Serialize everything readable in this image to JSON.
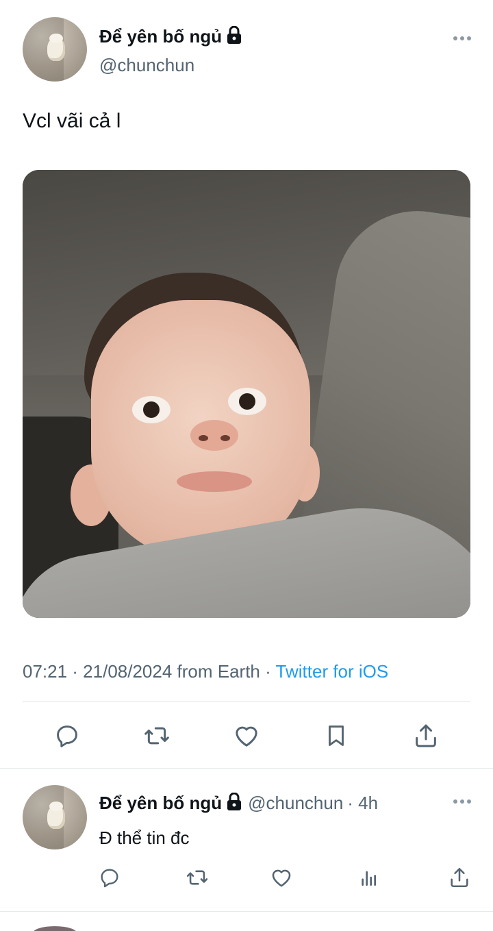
{
  "tweet": {
    "author_name": "Để yên bố ngủ",
    "author_handle": "@chunchun",
    "text": "Vcl vãi cả l",
    "time": "07:21 · 21/08/2024 from Earth · ",
    "source": "Twitter for iOS",
    "icons": {
      "lock": "lock-icon",
      "more": "more-horizontal-icon",
      "reply": "reply-icon",
      "retweet": "retweet-icon",
      "like": "heart-icon",
      "bookmark": "bookmark-icon",
      "share": "share-icon"
    }
  },
  "reply": {
    "author_name": "Để yên bố ngủ",
    "author_handle": "@chunchun",
    "time_ago": "· 4h",
    "text": "Đ thể tin đc",
    "icons": {
      "reply": "reply-icon",
      "retweet": "retweet-icon",
      "like": "heart-icon",
      "views": "analytics-icon",
      "share": "share-icon"
    }
  },
  "colors": {
    "text": "#0f1419",
    "secondary": "#536471",
    "link": "#1d9bf0",
    "icon": "#536471",
    "divider": "#dfe3e6"
  }
}
